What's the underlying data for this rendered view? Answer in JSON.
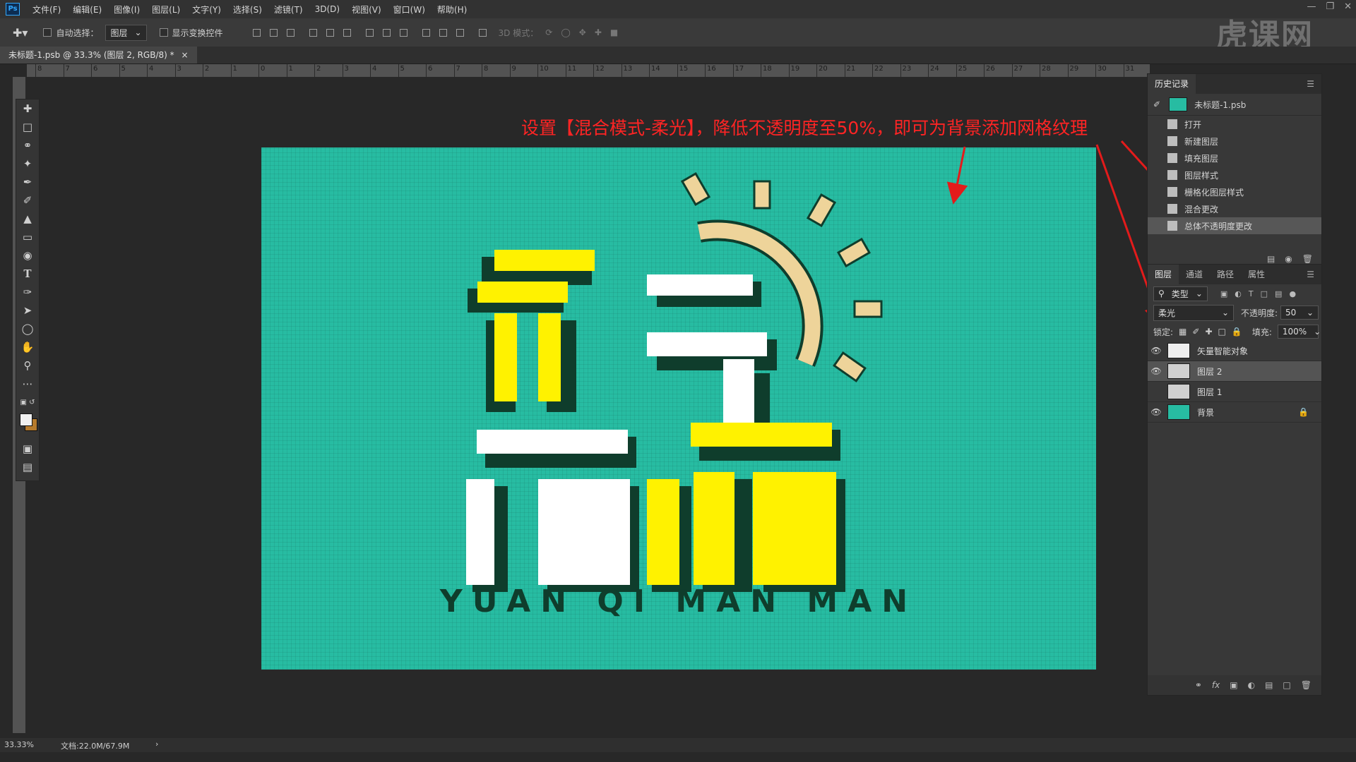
{
  "app": {
    "logo": "Ps",
    "menu": [
      "文件(F)",
      "编辑(E)",
      "图像(I)",
      "图层(L)",
      "文字(Y)",
      "选择(S)",
      "滤镜(T)",
      "3D(D)",
      "视图(V)",
      "窗口(W)",
      "帮助(H)"
    ]
  },
  "options_bar": {
    "auto_select_label": "自动选择：",
    "auto_select_value": "图层",
    "show_transform_label": "显示变换控件",
    "mode_3d_label": "3D 模式："
  },
  "watermark": "虎课网",
  "document": {
    "tab_title": "未标题-1.psb @ 33.3% (图层 2, RGB/8) *",
    "zoom": "33.33%",
    "doc_size": "文档:22.0M/67.9M"
  },
  "ruler_labels": [
    "8",
    "7",
    "6",
    "5",
    "4",
    "3",
    "2",
    "1",
    "0",
    "1",
    "2",
    "3",
    "4",
    "5",
    "6",
    "7",
    "8",
    "9",
    "10",
    "11",
    "12",
    "13",
    "14",
    "15",
    "16",
    "17",
    "18",
    "19",
    "20",
    "21",
    "22",
    "23",
    "24",
    "25",
    "26",
    "27",
    "28",
    "29",
    "30",
    "31"
  ],
  "annotation": "设置【混合模式-柔光】，降低不透明度至50%，即可为背景添加网格纹理",
  "artwork": {
    "subtitle": "YUAN QI MAN MAN",
    "bg_color": "#27bca2",
    "yellow": "#fff200",
    "dark": "#0f3d2c",
    "tan": "#eed49a"
  },
  "history": {
    "tabs": [
      "历史记录"
    ],
    "snapshot": "未标题-1.psb",
    "items": [
      "打开",
      "新建图层",
      "填充图层",
      "图层样式",
      "栅格化图层样式",
      "混合更改",
      "总体不透明度更改"
    ],
    "active_index": 6
  },
  "layers": {
    "tabs": [
      "图层",
      "通道",
      "路径",
      "属性"
    ],
    "filter_label": "类型",
    "blend_mode": "柔光",
    "opacity_label": "不透明度:",
    "opacity_value": "50",
    "lock_label": "锁定:",
    "fill_label": "填充:",
    "fill_value": "100%",
    "list": [
      {
        "name": "矢量智能对象",
        "visible": true
      },
      {
        "name": "图层 2",
        "visible": true,
        "active": true
      },
      {
        "name": "图层 1",
        "visible": false
      },
      {
        "name": "背景",
        "visible": true,
        "locked": true
      }
    ]
  },
  "icons": [
    "move-icon",
    "marquee-icon",
    "lasso-icon",
    "magic-wand-icon",
    "eyedropper-icon",
    "brush-icon",
    "stamp-icon",
    "eraser-icon",
    "paint-bucket-icon",
    "type-icon",
    "pen-icon",
    "path-select-icon",
    "ellipse-icon",
    "hand-icon",
    "zoom-icon",
    "more-icon",
    "eye-icon",
    "lock-icon",
    "trash-icon"
  ]
}
